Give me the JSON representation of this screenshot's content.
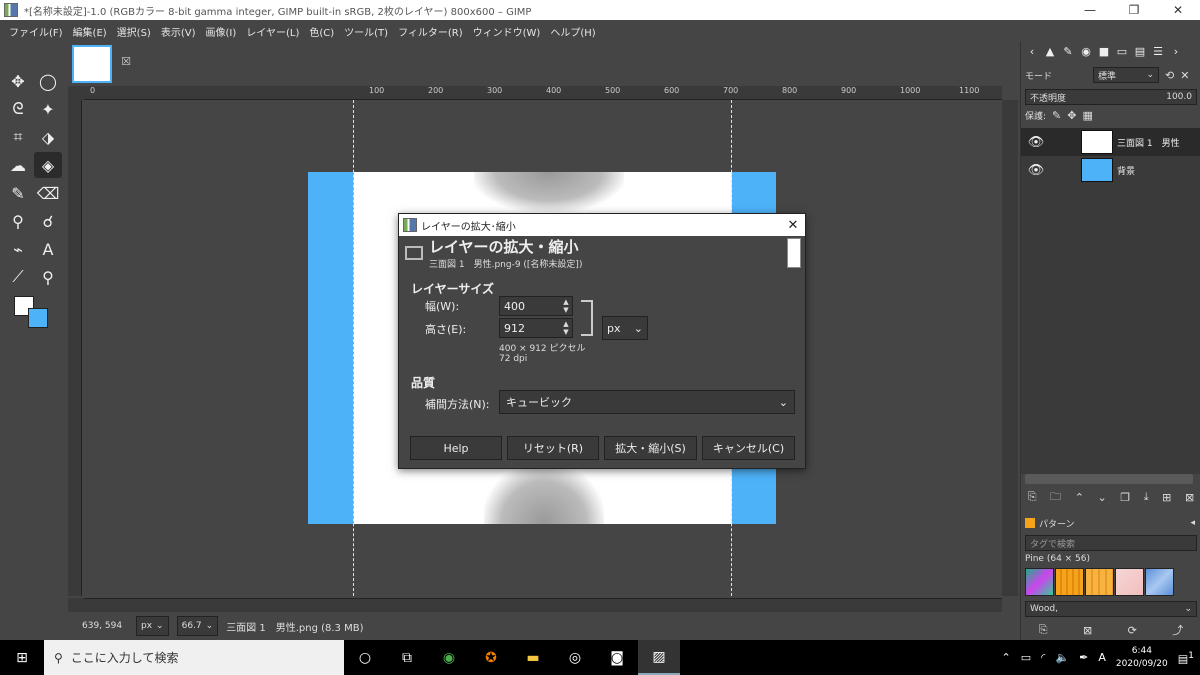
{
  "window": {
    "title": "*[名称未設定]-1.0 (RGBカラー 8-bit gamma integer, GIMP built-in sRGB, 2枚のレイヤー) 800x600 – GIMP",
    "minimize": "—",
    "maximize": "❐",
    "close": "✕"
  },
  "menu": [
    "ファイル(F)",
    "編集(E)",
    "選択(S)",
    "表示(V)",
    "画像(I)",
    "レイヤー(L)",
    "色(C)",
    "ツール(T)",
    "フィルター(R)",
    "ウィンドウ(W)",
    "ヘルプ(H)"
  ],
  "ruler_top_labels": [
    "0",
    "100",
    "200",
    "300",
    "400",
    "500",
    "600",
    "700",
    "800",
    "900",
    "1000",
    "1100"
  ],
  "status": {
    "coords": "639, 594",
    "unit": "px",
    "zoom": "66.7",
    "layer_info": "三面図 1　男性.png (8.3 MB)"
  },
  "dock": {
    "mode_label": "モード",
    "mode_value": "標準",
    "opacity_label": "不透明度",
    "opacity_value": "100.0",
    "lock_label": "保護:",
    "layers": [
      {
        "name": "三面図 1　男性",
        "visible": true,
        "selected": true
      },
      {
        "name": "背景",
        "visible": true,
        "selected": false
      }
    ],
    "patterns_title": "パターン",
    "pattern_tag_placeholder": "タグで検索",
    "pattern_name": "Pine (64 × 56)",
    "pattern_selected": "Wood,"
  },
  "dialog": {
    "window_title": "レイヤーの拡大･縮小",
    "heading": "レイヤーの拡大・縮小",
    "subheading": "三面図 1　男性.png-9 ([名称未設定])",
    "section_size": "レイヤーサイズ",
    "width_label": "幅(W):",
    "width_value": "400",
    "height_label": "高さ(E):",
    "height_value": "912",
    "unit": "px",
    "pixel_info": "400 × 912 ピクセル",
    "dpi_info": "72 dpi",
    "section_quality": "品質",
    "interp_label": "補間方法(N):",
    "interp_value": "キュービック",
    "buttons": {
      "help": "Help",
      "reset": "リセット(R)",
      "scale": "拡大・縮小(S)",
      "cancel": "キャンセル(C)"
    }
  },
  "taskbar": {
    "search_placeholder": "ここに入力して検索",
    "time": "6:44",
    "date": "2020/09/20",
    "ime": "A",
    "notification_count": "1"
  },
  "colors": {
    "foreground": "#ffffff",
    "background": "#4db2f8"
  }
}
